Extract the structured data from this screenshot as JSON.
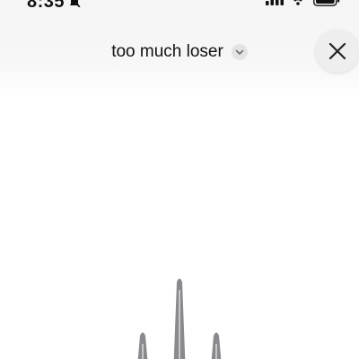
{
  "status_bar": {
    "time": "8:35",
    "icons": [
      "bell-slash-icon",
      "signal-icon",
      "wifi-icon",
      "battery-icon"
    ]
  },
  "header": {
    "title": "too much loser",
    "dropdown_icon": "chevron-down-icon",
    "close_icon": "close-icon"
  },
  "waveform": {
    "color": "#8a8a8e",
    "bar_levels": [
      0.07,
      0.34,
      0.74,
      0.34,
      0.07
    ]
  }
}
